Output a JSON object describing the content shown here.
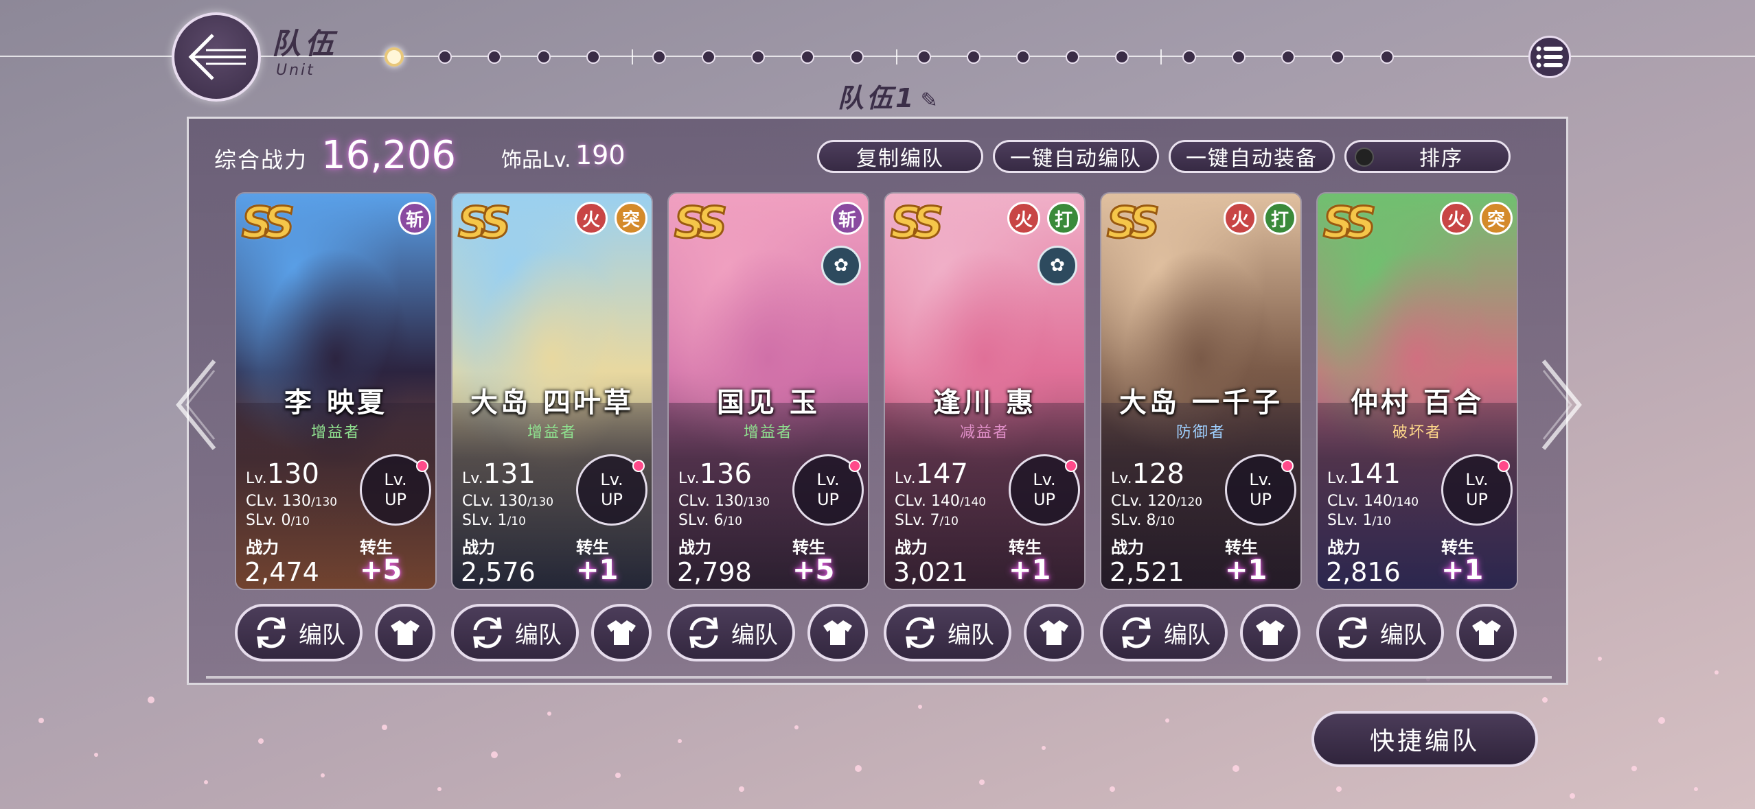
{
  "header": {
    "title": "队伍",
    "subtitle": "Unit",
    "team_name": "队伍1",
    "pencil": "✎"
  },
  "summary": {
    "power_label": "综合战力",
    "power_value": "16,206",
    "accessory_label": "饰品Lv.",
    "accessory_value": "190"
  },
  "buttons": {
    "copy": "复制编队",
    "auto_team": "一键自动编队",
    "auto_equip": "一键自动装备",
    "sort": "排序",
    "edit": "编队",
    "quick": "快捷编队"
  },
  "labels": {
    "lv": "Lv.",
    "clv": "CLv.",
    "slv": "SLv.",
    "lvup_1": "Lv.",
    "lvup_2": "UP",
    "power": "战力",
    "reborn": "转生",
    "rank": "SS"
  },
  "colors": {
    "accent_glow": "#d27ad6",
    "role_buff": "#8fe08f",
    "role_debuff": "#e08fc8",
    "role_defense": "#9fd0ff",
    "role_break": "#ffd88a"
  },
  "characters": [
    {
      "name": "李 映夏",
      "role": "增益者",
      "role_color": "#8fe08f",
      "lv": "130",
      "clv": "130",
      "clv_max": "/130",
      "slv": "0",
      "slv_max": "/10",
      "power": "2,474",
      "reborn": "+5",
      "badges": [
        {
          "text": "斩",
          "type": "slash"
        }
      ],
      "emblem": false,
      "art": [
        "#5aa0e8",
        "#2c2440",
        "#d87a3a"
      ]
    },
    {
      "name": "大岛 四叶草",
      "role": "增益者",
      "role_color": "#8fe08f",
      "lv": "131",
      "clv": "130",
      "clv_max": "/130",
      "slv": "1",
      "slv_max": "/10",
      "power": "2,576",
      "reborn": "+1",
      "badges": [
        {
          "text": "火",
          "type": "fire"
        },
        {
          "text": "突",
          "type": "pierce"
        }
      ],
      "emblem": false,
      "art": [
        "#9ad0f0",
        "#e8d8a0",
        "#2a3a4a"
      ]
    },
    {
      "name": "国见 玉",
      "role": "增益者",
      "role_color": "#8fe08f",
      "lv": "136",
      "clv": "130",
      "clv_max": "/130",
      "slv": "6",
      "slv_max": "/10",
      "power": "2,798",
      "reborn": "+5",
      "badges": [
        {
          "text": "斩",
          "type": "slash"
        }
      ],
      "emblem": true,
      "art": [
        "#f0a0c0",
        "#d070a8",
        "#3a2a3a"
      ]
    },
    {
      "name": "逢川 惠",
      "role": "减益者",
      "role_color": "#e08fc8",
      "lv": "147",
      "clv": "140",
      "clv_max": "/140",
      "slv": "7",
      "slv_max": "/10",
      "power": "3,021",
      "reborn": "+1",
      "badges": [
        {
          "text": "火",
          "type": "fire"
        },
        {
          "text": "打",
          "type": "hit"
        }
      ],
      "emblem": true,
      "art": [
        "#f0b0c8",
        "#e07098",
        "#4a2a3a"
      ]
    },
    {
      "name": "大岛 一千子",
      "role": "防御者",
      "role_color": "#9fd0ff",
      "lv": "128",
      "clv": "120",
      "clv_max": "/120",
      "slv": "8",
      "slv_max": "/10",
      "power": "2,521",
      "reborn": "+1",
      "badges": [
        {
          "text": "火",
          "type": "fire"
        },
        {
          "text": "打",
          "type": "hit"
        }
      ],
      "emblem": false,
      "art": [
        "#e0c0a0",
        "#7a5a48",
        "#2a2028"
      ]
    },
    {
      "name": "仲村 百合",
      "role": "破坏者",
      "role_color": "#ffd88a",
      "lv": "141",
      "clv": "140",
      "clv_max": "/140",
      "slv": "1",
      "slv_max": "/10",
      "power": "2,816",
      "reborn": "+1",
      "badges": [
        {
          "text": "火",
          "type": "fire"
        },
        {
          "text": "突",
          "type": "pierce"
        }
      ],
      "emblem": false,
      "art": [
        "#70c070",
        "#d07080",
        "#3a3a80"
      ]
    }
  ]
}
